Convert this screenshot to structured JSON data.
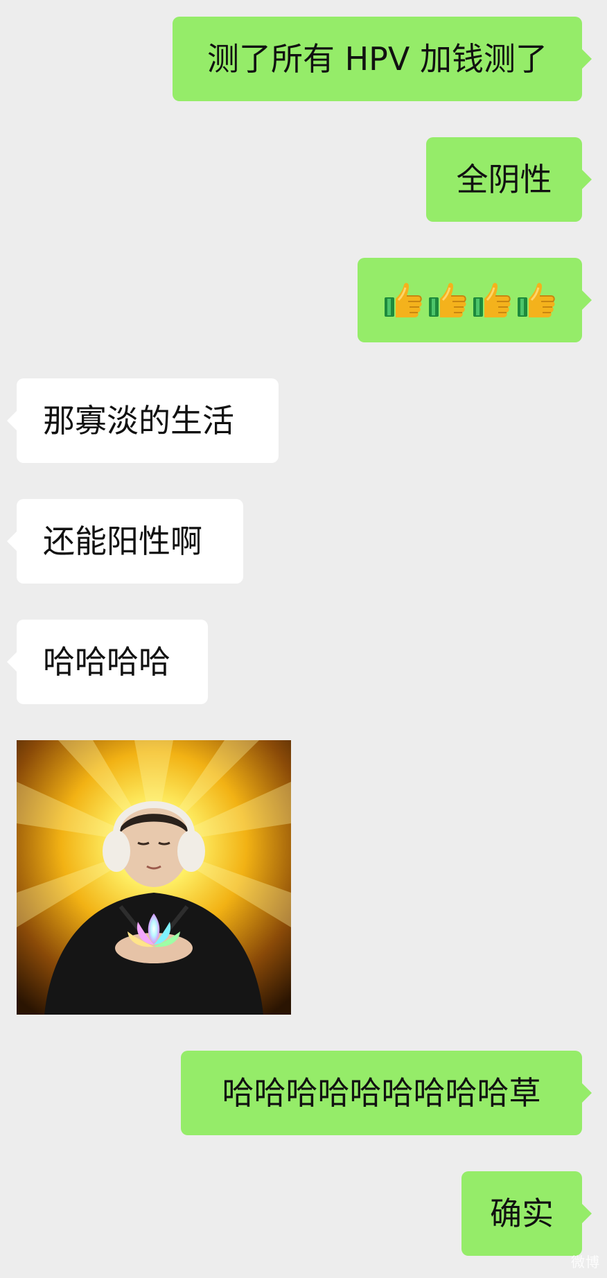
{
  "messages": {
    "m1": "测了所有 HPV 加钱测了",
    "m2": "全阴性",
    "m3": "👍👍👍👍",
    "m4": "那寡淡的生活",
    "m5": "还能阳性啊",
    "m6": "哈哈哈哈",
    "m7": "哈哈哈哈哈哈哈哈哈草",
    "m8": "确实"
  },
  "icons": {
    "thumbs": [
      "thumbs-up-icon",
      "thumbs-up-icon",
      "thumbs-up-icon",
      "thumbs-up-icon"
    ]
  },
  "colors": {
    "background": "#ededed",
    "outgoing_bubble": "#95ec69",
    "incoming_bubble": "#ffffff"
  },
  "watermark": "微博"
}
